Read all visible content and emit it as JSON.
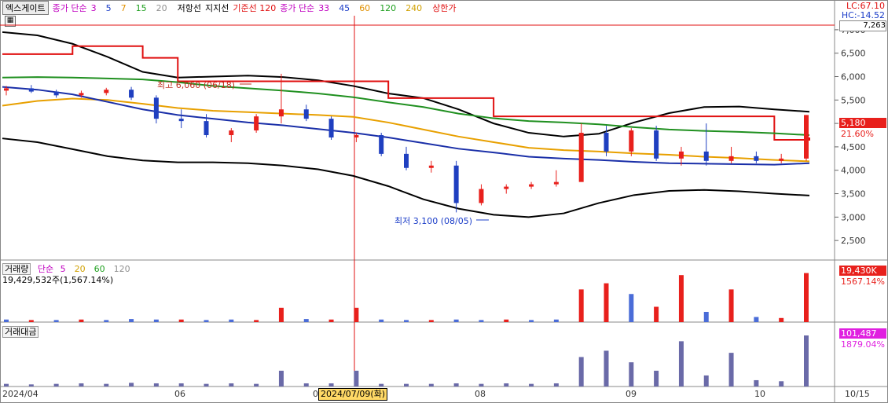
{
  "header": {
    "stock_tab": "엑스게이트",
    "ma_title": "종가 단순",
    "ma_periods": [
      {
        "label": "3",
        "color": "#c000c0"
      },
      {
        "label": "5",
        "color": "#1a3cc8"
      },
      {
        "label": "7",
        "color": "#e09000"
      },
      {
        "label": "15",
        "color": "#20a020"
      },
      {
        "label": "20",
        "color": "#909090"
      }
    ],
    "line_low": "저항선",
    "line_support": "지지선",
    "line_base": "기준선 120",
    "ma2_title": "종가 단순",
    "ma2_periods": [
      {
        "label": "33",
        "color": "#c000c0"
      },
      {
        "label": "45",
        "color": "#1a3cc8"
      },
      {
        "label": "60",
        "color": "#e09000"
      },
      {
        "label": "120",
        "color": "#20a020"
      },
      {
        "label": "240",
        "color": "#d0a000"
      }
    ],
    "upper_limit": "상한가",
    "lc": "LC:67.10",
    "hc": "HC:-14.52"
  },
  "annotations": {
    "high": "최고 6,060 (06/18)",
    "low": "최저 3,100 (08/05)",
    "price_box": "7,263",
    "close_box": "5,180",
    "change_pct": "21.60%",
    "crosshair_date": "2024/07/09(화)"
  },
  "volume_panel": {
    "title": "거래량",
    "ma_title": "단순",
    "ma_periods": [
      {
        "label": "5",
        "color": "#c000c0"
      },
      {
        "label": "20",
        "color": "#d0a000"
      },
      {
        "label": "60",
        "color": "#20a020"
      },
      {
        "label": "120",
        "color": "#909090"
      }
    ],
    "summary": "19,429,532주(1,567.14%)",
    "box": "19,430K",
    "pct": "1567.14%"
  },
  "amount_panel": {
    "title": "거래대금",
    "box": "101,487",
    "pct": "1879.04%"
  },
  "x_labels": [
    "2024/04",
    "06",
    "07",
    "08",
    "09",
    "10",
    "10/15"
  ],
  "colors": {
    "up": "#e8201c",
    "down": "#1f3fc0",
    "vol_down": "#4a6cd8",
    "amount": "#6a6aa8"
  },
  "chart_data": {
    "type": "candlestick",
    "y_ticks": [
      7000,
      6500,
      6000,
      5500,
      5000,
      4500,
      4000,
      3500,
      3000,
      2500
    ],
    "y_tick_labels": [
      "7,000",
      "6,500",
      "6,000",
      "5,500",
      "5,000",
      "4,500",
      "4,000",
      "3,500",
      "3,000",
      "2,500"
    ],
    "ylim": [
      2100,
      7300
    ],
    "high": 6060,
    "low": 3100,
    "last_close": 5180,
    "series": [
      {
        "name": "black band upper",
        "color": "#000000",
        "values": [
          6950,
          6880,
          6700,
          6420,
          6100,
          5980,
          6000,
          6020,
          5990,
          5920,
          5800,
          5640,
          5540,
          5300,
          5000,
          4800,
          4720,
          4780,
          5020,
          5220,
          5350,
          5360,
          5300,
          5250
        ]
      },
      {
        "name": "black band lower",
        "color": "#000000",
        "values": [
          4680,
          4600,
          4450,
          4300,
          4210,
          4170,
          4170,
          4150,
          4100,
          4020,
          3880,
          3660,
          3380,
          3180,
          3050,
          3000,
          3080,
          3300,
          3470,
          3560,
          3580,
          3550,
          3500,
          3460
        ]
      },
      {
        "name": "red resistance",
        "color": "#e01010",
        "values": [
          6480,
          6480,
          6650,
          6650,
          6400,
          5900,
          5900,
          5900,
          5900,
          5900,
          5900,
          5540,
          5540,
          5540,
          5150,
          5150,
          5150,
          5150,
          5150,
          5150,
          5150,
          5150,
          4650,
          4700
        ]
      },
      {
        "name": "orange long ma",
        "color": "#e8a000",
        "values": [
          5380,
          5480,
          5530,
          5500,
          5420,
          5330,
          5270,
          5240,
          5210,
          5180,
          5140,
          5020,
          4870,
          4720,
          4600,
          4480,
          4430,
          4400,
          4360,
          4330,
          4290,
          4260,
          4220,
          4190
        ]
      },
      {
        "name": "green ma120",
        "color": "#209020",
        "values": [
          5980,
          5990,
          5980,
          5960,
          5940,
          5880,
          5800,
          5750,
          5700,
          5640,
          5560,
          5450,
          5350,
          5210,
          5110,
          5050,
          5020,
          4980,
          4920,
          4870,
          4840,
          4820,
          4790,
          4750
        ]
      },
      {
        "name": "blue ma45",
        "color": "#1a2fa8",
        "values": [
          5780,
          5720,
          5620,
          5460,
          5300,
          5180,
          5100,
          5020,
          4960,
          4880,
          4800,
          4700,
          4580,
          4460,
          4380,
          4290,
          4250,
          4220,
          4180,
          4150,
          4140,
          4130,
          4120,
          4150
        ]
      }
    ],
    "candles": [
      {
        "o": 5700,
        "h": 5800,
        "l": 5600,
        "c": 5750
      },
      {
        "o": 5750,
        "h": 5820,
        "l": 5650,
        "c": 5680
      },
      {
        "o": 5680,
        "h": 5720,
        "l": 5550,
        "c": 5600
      },
      {
        "o": 5600,
        "h": 5700,
        "l": 5550,
        "c": 5650
      },
      {
        "o": 5650,
        "h": 5760,
        "l": 5600,
        "c": 5720
      },
      {
        "o": 5720,
        "h": 5780,
        "l": 5500,
        "c": 5550
      },
      {
        "o": 5550,
        "h": 5600,
        "l": 5000,
        "c": 5100
      },
      {
        "o": 5100,
        "h": 5300,
        "l": 4900,
        "c": 5050
      },
      {
        "o": 5050,
        "h": 5200,
        "l": 4700,
        "c": 4750
      },
      {
        "o": 4750,
        "h": 4900,
        "l": 4600,
        "c": 4850
      },
      {
        "o": 4850,
        "h": 5200,
        "l": 4800,
        "c": 5150
      },
      {
        "o": 5150,
        "h": 6060,
        "l": 5000,
        "c": 5300
      },
      {
        "o": 5300,
        "h": 5400,
        "l": 5050,
        "c": 5100
      },
      {
        "o": 5100,
        "h": 5150,
        "l": 4650,
        "c": 4700
      },
      {
        "o": 4700,
        "h": 4800,
        "l": 4600,
        "c": 4750
      },
      {
        "o": 4750,
        "h": 4800,
        "l": 4300,
        "c": 4350
      },
      {
        "o": 4350,
        "h": 4500,
        "l": 4000,
        "c": 4050
      },
      {
        "o": 4050,
        "h": 4200,
        "l": 3950,
        "c": 4100
      },
      {
        "o": 4100,
        "h": 4200,
        "l": 3100,
        "c": 3300
      },
      {
        "o": 3300,
        "h": 3700,
        "l": 3250,
        "c": 3600
      },
      {
        "o": 3600,
        "h": 3700,
        "l": 3500,
        "c": 3650
      },
      {
        "o": 3650,
        "h": 3750,
        "l": 3600,
        "c": 3700
      },
      {
        "o": 3700,
        "h": 4000,
        "l": 3650,
        "c": 3750
      },
      {
        "o": 3750,
        "h": 5000,
        "l": 3800,
        "c": 4800
      },
      {
        "o": 4800,
        "h": 4950,
        "l": 4300,
        "c": 4400
      },
      {
        "o": 4400,
        "h": 4900,
        "l": 4300,
        "c": 4850
      },
      {
        "o": 4850,
        "h": 4950,
        "l": 4200,
        "c": 4250
      },
      {
        "o": 4250,
        "h": 4500,
        "l": 4100,
        "c": 4400
      },
      {
        "o": 4400,
        "h": 5000,
        "l": 4100,
        "c": 4200
      },
      {
        "o": 4200,
        "h": 4500,
        "l": 4150,
        "c": 4300
      },
      {
        "o": 4300,
        "h": 4400,
        "l": 4150,
        "c": 4200
      },
      {
        "o": 4200,
        "h": 4350,
        "l": 4150,
        "c": 4250
      },
      {
        "o": 4250,
        "h": 5180,
        "l": 4200,
        "c": 5180
      }
    ],
    "volume": [
      {
        "v": 0.05,
        "up": false
      },
      {
        "v": 0.04,
        "up": true
      },
      {
        "v": 0.04,
        "up": false
      },
      {
        "v": 0.05,
        "up": true
      },
      {
        "v": 0.04,
        "up": false
      },
      {
        "v": 0.06,
        "up": false
      },
      {
        "v": 0.05,
        "up": false
      },
      {
        "v": 0.05,
        "up": true
      },
      {
        "v": 0.04,
        "up": false
      },
      {
        "v": 0.05,
        "up": false
      },
      {
        "v": 0.04,
        "up": true
      },
      {
        "v": 0.28,
        "up": true
      },
      {
        "v": 0.06,
        "up": false
      },
      {
        "v": 0.05,
        "up": true
      },
      {
        "v": 0.28,
        "up": true
      },
      {
        "v": 0.05,
        "up": false
      },
      {
        "v": 0.04,
        "up": false
      },
      {
        "v": 0.04,
        "up": true
      },
      {
        "v": 0.05,
        "up": false
      },
      {
        "v": 0.04,
        "up": false
      },
      {
        "v": 0.05,
        "up": true
      },
      {
        "v": 0.04,
        "up": false
      },
      {
        "v": 0.05,
        "up": false
      },
      {
        "v": 0.64,
        "up": true
      },
      {
        "v": 0.76,
        "up": true
      },
      {
        "v": 0.55,
        "up": false
      },
      {
        "v": 0.3,
        "up": true
      },
      {
        "v": 0.92,
        "up": true
      },
      {
        "v": 0.2,
        "up": false
      },
      {
        "v": 0.64,
        "up": true
      },
      {
        "v": 0.1,
        "up": false
      },
      {
        "v": 0.08,
        "up": true
      },
      {
        "v": 0.96,
        "up": true
      }
    ],
    "amount": [
      0.05,
      0.04,
      0.05,
      0.06,
      0.05,
      0.07,
      0.06,
      0.06,
      0.05,
      0.06,
      0.05,
      0.3,
      0.06,
      0.06,
      0.3,
      0.05,
      0.05,
      0.05,
      0.06,
      0.05,
      0.06,
      0.05,
      0.06,
      0.56,
      0.68,
      0.46,
      0.3,
      0.86,
      0.21,
      0.64,
      0.12,
      0.1,
      0.97
    ]
  }
}
